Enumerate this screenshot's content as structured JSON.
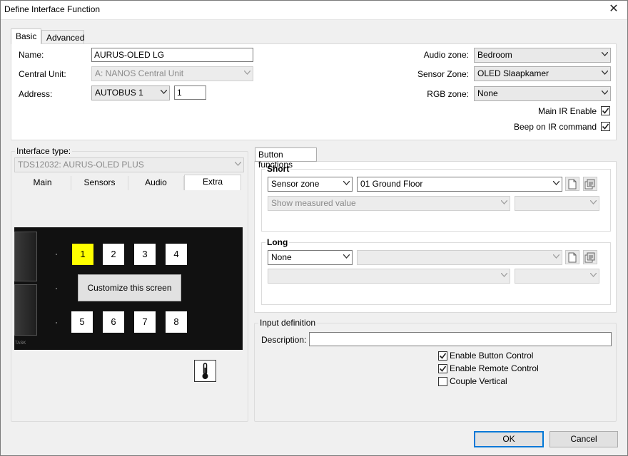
{
  "window": {
    "title": "Define Interface Function",
    "close_glyph": "✕"
  },
  "tabs": [
    {
      "label": "Basic"
    },
    {
      "label": "Advanced"
    }
  ],
  "basic": {
    "name_label": "Name:",
    "name_value": "AURUS-OLED LG",
    "central_unit_label": "Central Unit:",
    "central_unit_value": "A: NANOS Central Unit",
    "address_label": "Address:",
    "address_bus_value": "AUTOBUS 1",
    "address_number_value": "1",
    "audio_zone_label": "Audio zone:",
    "audio_zone_value": "Bedroom",
    "sensor_zone_label": "Sensor Zone:",
    "sensor_zone_value": "OLED Slaapkamer",
    "rgb_zone_label": "RGB zone:",
    "rgb_zone_value": "None",
    "main_ir_enable_label": "Main IR Enable",
    "main_ir_enable_checked": true,
    "beep_ir_label": "Beep on IR command",
    "beep_ir_checked": true
  },
  "interface_type": {
    "label": "Interface type:",
    "value": "TDS12032: AURUS-OLED PLUS",
    "subtabs": [
      {
        "label": "Main"
      },
      {
        "label": "Sensors"
      },
      {
        "label": "Audio"
      },
      {
        "label": "Extra"
      }
    ],
    "active_subtab": "Extra",
    "preview": {
      "top_buttons": [
        "1",
        "2",
        "3",
        "4"
      ],
      "bottom_buttons": [
        "5",
        "6",
        "7",
        "8"
      ],
      "selected_button": "1",
      "customize_label": "Customize this screen",
      "corner_text": "TASK"
    },
    "thermometer_icon": "thermometer-icon"
  },
  "button_functions": {
    "tab_label": "Button functions",
    "short": {
      "title": "Short",
      "type_value": "Sensor zone",
      "target_value": "01  Ground Floor",
      "measure_value": "Show measured value",
      "extra_value": ""
    },
    "long": {
      "title": "Long",
      "type_value": "None",
      "target_value": "",
      "row2_value": "",
      "extra_value": ""
    }
  },
  "input_definition": {
    "title": "Input definition",
    "description_label": "Description:",
    "description_value": "",
    "checks": [
      {
        "label": "Enable Button Control",
        "checked": true
      },
      {
        "label": "Enable Remote Control",
        "checked": true
      },
      {
        "label": "Couple Vertical",
        "checked": false
      }
    ]
  },
  "footer": {
    "ok_label": "OK",
    "cancel_label": "Cancel"
  },
  "colors": {
    "selected_button": "#ffff00",
    "accent": "#0078d7"
  }
}
